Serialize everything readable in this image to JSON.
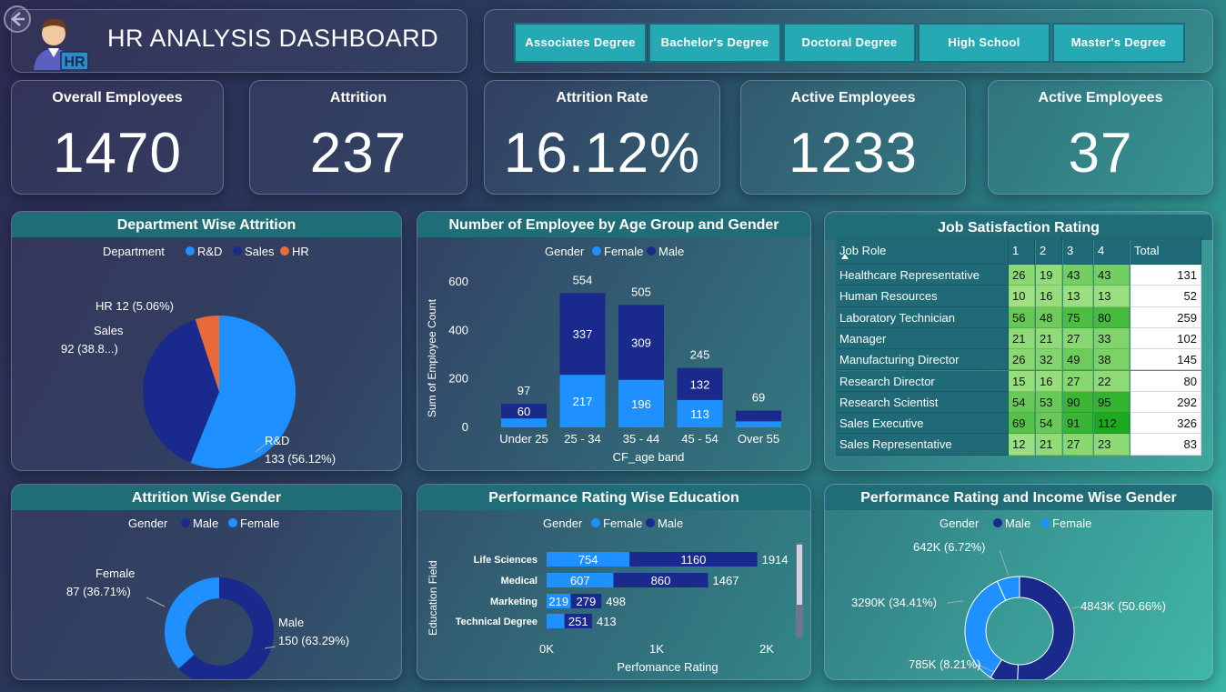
{
  "header": {
    "title": "HR ANALYSIS DASHBOARD",
    "logo_badge": "HR",
    "back_icon": "back-arrow-icon"
  },
  "degree_filters": [
    "Associates Degree",
    "Bachelor's Degree",
    "Doctoral Degree",
    "High School",
    "Master's Degree"
  ],
  "kpis": [
    {
      "label": "Overall Employees",
      "value": "1470"
    },
    {
      "label": "Attrition",
      "value": "237"
    },
    {
      "label": "Attrition Rate",
      "value": "16.12%"
    },
    {
      "label": "Active Employees",
      "value": "1233"
    },
    {
      "label": "Active Employees",
      "value": "37"
    }
  ],
  "colors": {
    "rd": "#1e90ff",
    "sales": "#1a2a8c",
    "hr": "#e8693a",
    "female": "#1e90ff",
    "male": "#1a2a8c",
    "title_bar": "#206d78"
  },
  "chart_data": [
    {
      "type": "pie",
      "title": "Department Wise Attrition",
      "legend_title": "Department",
      "legend": [
        "R&D",
        "Sales",
        "HR"
      ],
      "slices": [
        {
          "name": "R&D",
          "value": 133,
          "label": "133 (56.12%)"
        },
        {
          "name": "Sales",
          "value": 92,
          "label": "92 (38.8...)"
        },
        {
          "name": "HR",
          "value": 12,
          "label": "HR 12 (5.06%)"
        }
      ],
      "data_label_prefix_rd": "R&D",
      "data_label_prefix_sales": "Sales"
    },
    {
      "type": "bar",
      "title": "Number of Employee by Age Group and Gender",
      "legend_title": "Gender",
      "xlabel": "CF_age band",
      "ylabel": "Sum of Employee Count",
      "ylim": [
        0,
        600
      ],
      "yticks": [
        "0",
        "200",
        "400",
        "600"
      ],
      "categories": [
        "Under 25",
        "25 - 34",
        "35 - 44",
        "45 - 54",
        "Over 55"
      ],
      "series": [
        {
          "name": "Female",
          "values": [
            37,
            217,
            196,
            113,
            25
          ]
        },
        {
          "name": "Male",
          "values": [
            60,
            337,
            309,
            132,
            44
          ]
        }
      ],
      "totals": [
        "97",
        "554",
        "505",
        "245",
        "69"
      ],
      "female_labels": [
        "",
        "217",
        "196",
        "113",
        ""
      ],
      "male_labels": [
        "60",
        "337",
        "309",
        "132",
        ""
      ]
    },
    {
      "type": "table",
      "title": "Job Satisfaction Rating",
      "columns": [
        "Job Role",
        "1",
        "2",
        "3",
        "4",
        "Total"
      ],
      "rows": [
        [
          "Healthcare Representative",
          "26",
          "19",
          "43",
          "43",
          "131"
        ],
        [
          "Human Resources",
          "10",
          "16",
          "13",
          "13",
          "52"
        ],
        [
          "Laboratory Technician",
          "56",
          "48",
          "75",
          "80",
          "259"
        ],
        [
          "Manager",
          "21",
          "21",
          "27",
          "33",
          "102"
        ],
        [
          "Manufacturing Director",
          "26",
          "32",
          "49",
          "38",
          "145"
        ],
        [
          "Research Director",
          "15",
          "16",
          "27",
          "22",
          "80"
        ],
        [
          "Research Scientist",
          "54",
          "53",
          "90",
          "95",
          "292"
        ],
        [
          "Sales Executive",
          "69",
          "54",
          "91",
          "112",
          "326"
        ],
        [
          "Sales Representative",
          "12",
          "21",
          "27",
          "23",
          "83"
        ]
      ]
    },
    {
      "type": "pie",
      "title": "Attrition Wise Gender",
      "legend_title": "Gender",
      "legend": [
        "Male",
        "Female"
      ],
      "slices": [
        {
          "name": "Male",
          "value": 150,
          "label": "150 (63.29%)"
        },
        {
          "name": "Female",
          "value": 87,
          "label": "87 (36.71%)"
        }
      ]
    },
    {
      "type": "bar",
      "title": "Performance Rating Wise Education",
      "legend_title": "Gender",
      "xlabel": "Perfomance Rating",
      "ylabel": "Education Field",
      "xlim": [
        0,
        2000
      ],
      "xticks": [
        "0K",
        "1K",
        "2K"
      ],
      "categories": [
        "Life Sciences",
        "Medical",
        "Marketing",
        "Technical Degree"
      ],
      "series": [
        {
          "name": "Female",
          "values": [
            754,
            607,
            219,
            162
          ]
        },
        {
          "name": "Male",
          "values": [
            1160,
            860,
            279,
            251
          ]
        }
      ],
      "totals": [
        "1914",
        "1467",
        "498",
        "413"
      ],
      "female_labels": [
        "754",
        "607",
        "219",
        ""
      ],
      "male_labels": [
        "1160",
        "860",
        "279",
        "251"
      ]
    },
    {
      "type": "pie",
      "title": "Performance Rating and Income Wise Gender",
      "legend_title": "Gender",
      "legend": [
        "Male",
        "Female"
      ],
      "slices": [
        {
          "name": "Male",
          "value": 4843,
          "label": "4843K (50.66%)"
        },
        {
          "name": "Male",
          "value": 785,
          "label": "785K (8.21%)"
        },
        {
          "name": "Female",
          "value": 3290,
          "label": "3290K (34.41%)"
        },
        {
          "name": "Female",
          "value": 642,
          "label": "642K (6.72%)"
        }
      ]
    }
  ]
}
